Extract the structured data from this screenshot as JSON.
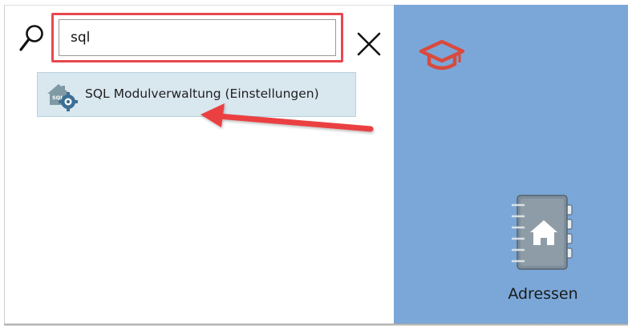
{
  "search": {
    "value": "sql",
    "placeholder": ""
  },
  "results": [
    {
      "label": "SQL Modulverwaltung (Einstellungen)",
      "icon": "sql-settings-icon"
    }
  ],
  "tiles": [
    {
      "label": "Adressen",
      "icon": "address-book-icon"
    }
  ],
  "colors": {
    "panel_blue": "#7ba7d8",
    "highlight_red": "#e8474f",
    "result_bg": "#d9e7ef",
    "cap_red": "#d94a3d"
  },
  "icons": {
    "search": "magnifier-icon",
    "close": "close-icon",
    "brand": "graduation-cap-icon"
  }
}
